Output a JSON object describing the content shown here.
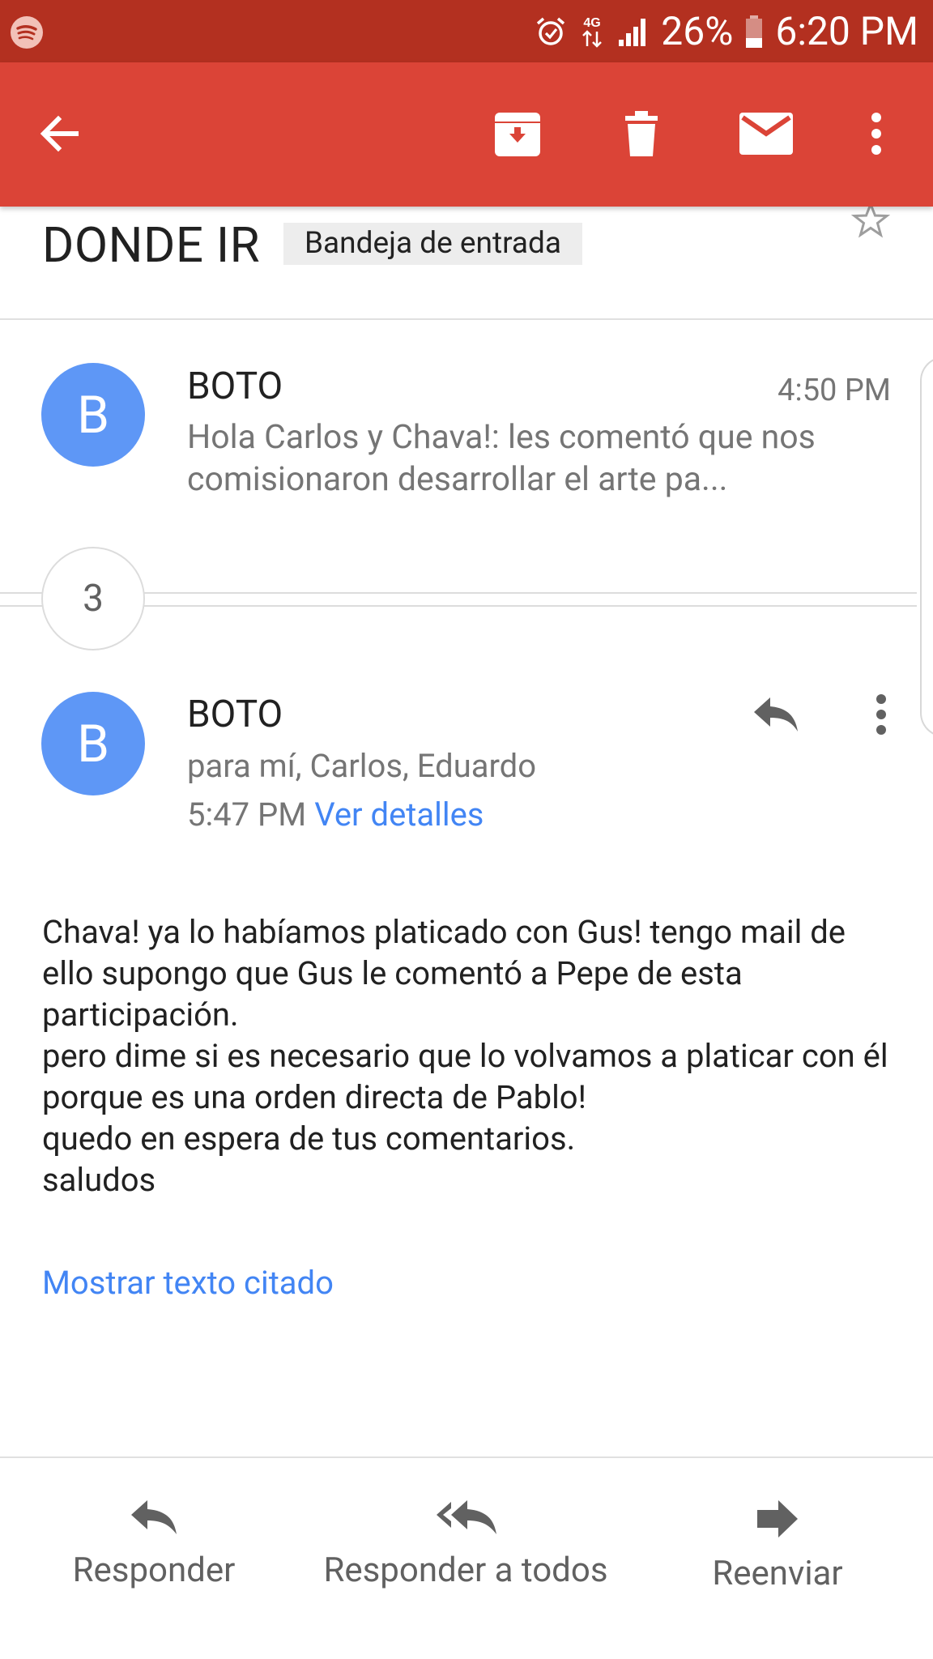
{
  "status_bar": {
    "battery": "26%",
    "time": "6:20 PM",
    "network": "4G",
    "icons": [
      "spotify-icon",
      "alarm-icon",
      "network-4g-icon",
      "signal-icon",
      "battery-icon"
    ]
  },
  "toolbar": {
    "icons": [
      "back-arrow-icon",
      "archive-icon",
      "delete-icon",
      "mark-unread-icon",
      "more-vert-icon"
    ]
  },
  "thread": {
    "subject": "DONDE IR",
    "label": "Bandeja de entrada"
  },
  "collapsed_message": {
    "avatar_letter": "B",
    "sender": "BOTO",
    "time": "4:50 PM",
    "snippet": "Hola Carlos y Chava!: les comentó que nos comisionaron desarrollar el arte pa..."
  },
  "hidden_count": "3",
  "expanded_message": {
    "avatar_letter": "B",
    "sender": "BOTO",
    "recipients": "para mí, Carlos, Eduardo",
    "time": "5:47 PM",
    "details_link": "Ver detalles",
    "body": "Chava! ya lo habíamos platicado con Gus! tengo mail de ello supongo que Gus le comentó a Pepe de esta participación.\npero dime si es necesario que lo volvamos a platicar con él porque es una orden directa de Pablo!\nquedo en espera de tus comentarios.\nsaludos",
    "quoted_link": "Mostrar texto citado"
  },
  "bottom_actions": {
    "reply": "Responder",
    "reply_all": "Responder a todos",
    "forward": "Reenviar"
  },
  "colors": {
    "status_bar": "#b33020",
    "toolbar": "#db4437",
    "avatar": "#5e97f6",
    "link": "#4285f4"
  }
}
